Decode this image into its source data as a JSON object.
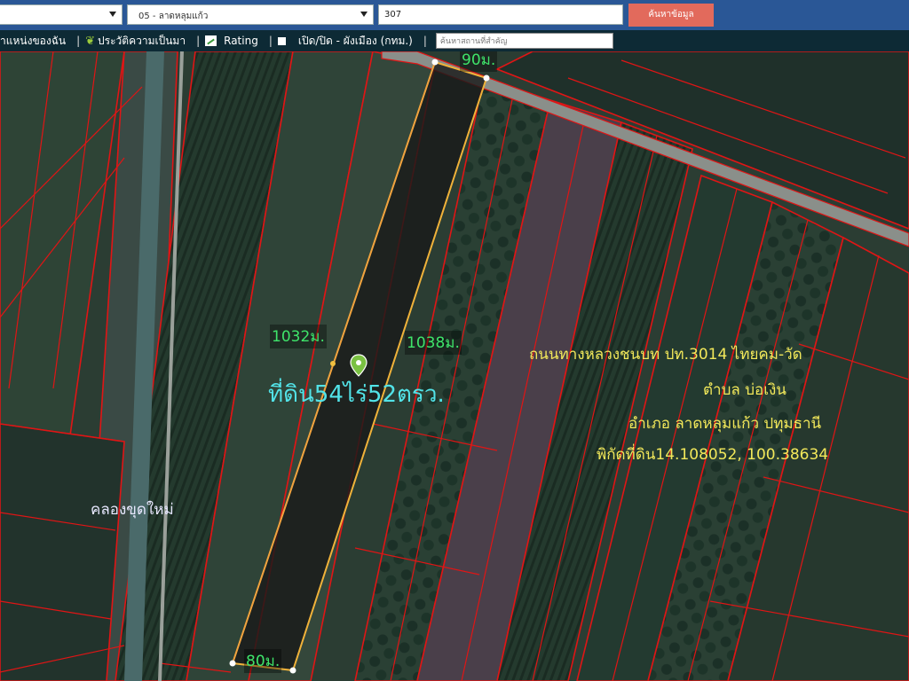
{
  "search": {
    "province_value": "",
    "district_value": "05 - ลาดหลุมแก้ว",
    "parcel_value": "307",
    "button_label": "ค้นหาข้อมูล"
  },
  "toolbar": {
    "my_location": "ำแหน่งของฉัน",
    "history": "ประวัติความเป็นมา",
    "rating": "Rating",
    "toggle_layer": "เปิด/ปิด - ผังเมือง (กทม.)",
    "place_search_placeholder": "ค้นหาสถานที่สำคัญ"
  },
  "map": {
    "labels": {
      "top_width": "90ม.",
      "left_length": "1032ม.",
      "right_length": "1038ม.",
      "bottom_width": "80ม.",
      "land_area": "ที่ดิน54ไร่52ตรว.",
      "road": "ถนนทางหลวงชนบท ปท.3014 ไทยคม-วัด",
      "subdistrict": "ตำบล บ่อเงิน",
      "district": "อำเภอ ลาดหลุมแก้ว ปทุมธานี",
      "coordinates": "พิกัดที่ดิน14.108052, 100.38634",
      "canal": "คลองขุดใหม่"
    },
    "colors": {
      "parcel_border": "#e01515",
      "selected_parcel": "#f0b23a",
      "marker": "#7ac142"
    },
    "icons": [
      "location-pin-icon"
    ]
  }
}
